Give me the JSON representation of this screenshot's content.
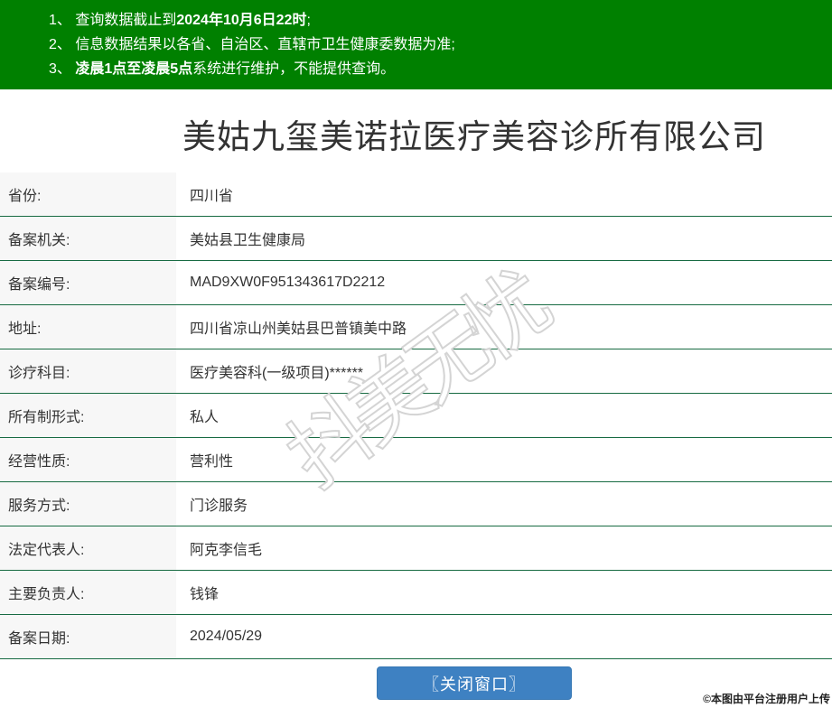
{
  "notice": {
    "lines": [
      {
        "pre": "1、 查询数据截止到",
        "bold": "2024年10月6日22时",
        "post": ";"
      },
      {
        "pre": "2、 信息数据结果以各省、自治区、直辖市卫生健康委数据为准;",
        "bold": "",
        "post": ""
      },
      {
        "pre": "3、 ",
        "bold": "凌晨1点至凌晨5点",
        "post": "系统进行维护，不能提供查询。"
      }
    ]
  },
  "title": "美姑九玺美诺拉医疗美容诊所有限公司",
  "table": {
    "rows": [
      {
        "label": "省份:",
        "value": "四川省"
      },
      {
        "label": "备案机关:",
        "value": "美姑县卫生健康局"
      },
      {
        "label": "备案编号:",
        "value": "MAD9XW0F951343617D2212"
      },
      {
        "label": "地址:",
        "value": "四川省凉山州美姑县巴普镇美中路"
      },
      {
        "label": "诊疗科目:",
        "value": "医疗美容科(一级项目)******"
      },
      {
        "label": "所有制形式:",
        "value": "私人"
      },
      {
        "label": "经营性质:",
        "value": "营利性"
      },
      {
        "label": "服务方式:",
        "value": "门诊服务"
      },
      {
        "label": "法定代表人:",
        "value": "阿克李信毛"
      },
      {
        "label": "主要负责人:",
        "value": "钱锋"
      },
      {
        "label": "备案日期:",
        "value": "2024/05/29"
      }
    ]
  },
  "button": {
    "label": "〖关闭窗口〗"
  },
  "watermark": {
    "text": "抖美无忧"
  },
  "credit": "©本图由平台注册用户上传",
  "colors": {
    "header_green": "#008000",
    "divider_green": "#176b42",
    "button_blue": "#3e81c2",
    "label_bg": "#f7f7f7"
  }
}
